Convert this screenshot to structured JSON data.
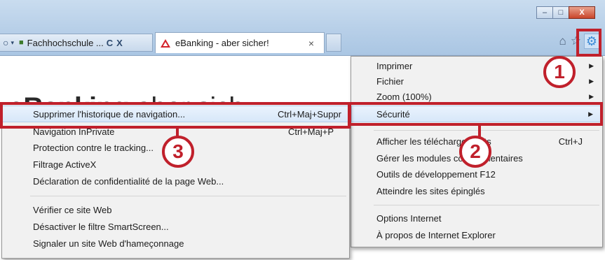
{
  "window": {
    "minimize_glyph": "–",
    "maximize_glyph": "□",
    "close_glyph": "X"
  },
  "toolbar": {
    "address_snippet": "Fachhochschule ...",
    "search_icon": "search-icon",
    "refresh_glyph": "C",
    "close_glyph": "X",
    "home_icon": "home-icon",
    "favorites_icon": "star-icon",
    "tools_icon": "gear-icon"
  },
  "tabs": [
    {
      "label": "eBanking - aber sicher!",
      "close_glyph": "×"
    }
  ],
  "page": {
    "brand_bold": "eBanking",
    "brand_light": " aber sich"
  },
  "main_menu": {
    "items": [
      {
        "label": "Imprimer",
        "shortcut": "",
        "submenu": true
      },
      {
        "label": "Fichier",
        "shortcut": "",
        "submenu": true
      },
      {
        "label": "Zoom (100%)",
        "shortcut": "",
        "submenu": true
      },
      {
        "label": "Sécurité",
        "shortcut": "",
        "submenu": true,
        "highlighted": true
      },
      {
        "label": "Afficher les téléchargements",
        "shortcut": "Ctrl+J"
      },
      {
        "label": "Gérer les modules complémentaires",
        "shortcut": ""
      },
      {
        "label": "Outils de développement F12",
        "shortcut": ""
      },
      {
        "label": "Atteindre les sites épinglés",
        "shortcut": ""
      },
      {
        "label": "Options Internet",
        "shortcut": ""
      },
      {
        "label": "À propos de Internet Explorer",
        "shortcut": ""
      }
    ]
  },
  "security_menu": {
    "items": [
      {
        "label": "Supprimer l'historique de navigation...",
        "shortcut": "Ctrl+Maj+Suppr",
        "highlighted": true
      },
      {
        "label": "Navigation InPrivate",
        "shortcut": "Ctrl+Maj+P"
      },
      {
        "label": "Protection contre le tracking...",
        "shortcut": ""
      },
      {
        "label": "Filtrage ActiveX",
        "shortcut": ""
      },
      {
        "label": "Déclaration de confidentialité de la page Web...",
        "shortcut": ""
      },
      {
        "label": "Vérifier ce site Web",
        "shortcut": ""
      },
      {
        "label": "Désactiver le filtre SmartScreen...",
        "shortcut": ""
      },
      {
        "label": "Signaler un site Web d'hameçonnage",
        "shortcut": ""
      }
    ]
  },
  "annotations": {
    "step1": "1",
    "step2": "2",
    "step3": "3"
  },
  "colors": {
    "annotation_red": "#c0202b",
    "menu_bg": "#f1f1f1",
    "chrome_blue": "#b7cfe8",
    "tools_gear": "#3a8ad6"
  }
}
